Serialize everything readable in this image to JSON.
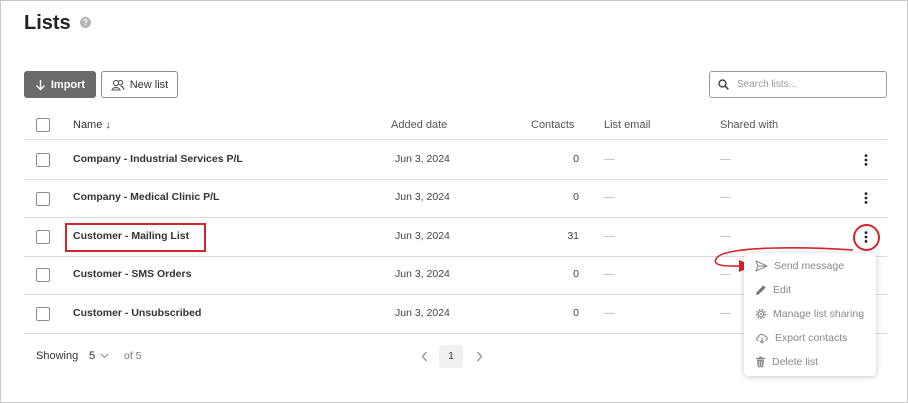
{
  "page": {
    "title": "Lists",
    "help_icon": "question-circle-icon",
    "help_glyph": "?"
  },
  "toolbar": {
    "import_label": "Import",
    "import_icon": "arrow-down-icon",
    "new_list_label": "New list",
    "new_list_icon": "people-icon",
    "search_placeholder": "Search lists...",
    "search_icon": "search-icon"
  },
  "table": {
    "headers": {
      "name": "Name ↓",
      "added_date": "Added date",
      "contacts": "Contacts",
      "list_email": "List email",
      "shared_with": "Shared with"
    },
    "rows": [
      {
        "name": "Company - Industrial Services P/L",
        "added_date": "Jun 3, 2024",
        "contacts": "0",
        "list_email": "—",
        "shared_with": "—"
      },
      {
        "name": "Company - Medical Clinic P/L",
        "added_date": "Jun 3, 2024",
        "contacts": "0",
        "list_email": "—",
        "shared_with": "—"
      },
      {
        "name": "Customer - Mailing List",
        "added_date": "Jun 3, 2024",
        "contacts": "31",
        "list_email": "—",
        "shared_with": "—"
      },
      {
        "name": "Customer - SMS Orders",
        "added_date": "Jun 3, 2024",
        "contacts": "0",
        "list_email": "—",
        "shared_with": "—"
      },
      {
        "name": "Customer - Unsubscribed",
        "added_date": "Jun 3, 2024",
        "contacts": "0",
        "list_email": "—",
        "shared_with": "—"
      }
    ]
  },
  "context_menu": {
    "items": [
      {
        "label": "Send message",
        "icon": "send-icon"
      },
      {
        "label": "Edit",
        "icon": "pencil-icon"
      },
      {
        "label": "Manage list sharing",
        "icon": "gear-icon"
      },
      {
        "label": "Export contacts",
        "icon": "cloud-download-icon"
      },
      {
        "label": "Delete list",
        "icon": "trash-icon"
      }
    ]
  },
  "footer": {
    "showing_label": "Showing",
    "page_size": "5",
    "of_label": "of 5",
    "current_page": "1"
  },
  "annotation": {
    "color": "#d6242b"
  },
  "colors": {
    "import_button_bg": "#6b6b6b",
    "text": "#222222",
    "muted": "#888888"
  }
}
